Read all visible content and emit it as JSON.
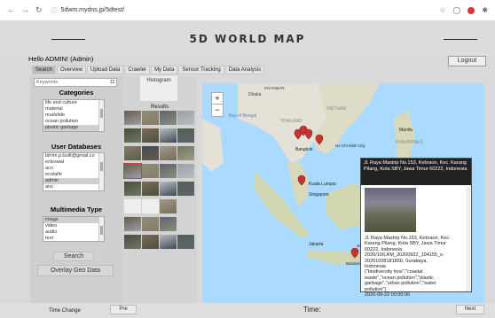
{
  "browser": {
    "url": "5dwm.mydns.jp/5dtest/"
  },
  "app": {
    "title": "5D WORLD MAP",
    "hello": "Hello ADMIN! (Admin)",
    "logout": "Logout"
  },
  "tabs": [
    "Search",
    "Overview",
    "Upload Data",
    "Crawler",
    "My Data",
    "Sensor Tracking",
    "Data Analysis"
  ],
  "search": {
    "keywords_placeholder": "Keywords"
  },
  "categories": {
    "title": "Categories",
    "items": [
      "life and culture",
      "material",
      "mudslide",
      "ocean pollution",
      "plastic garbage"
    ],
    "selected": "plastic garbage"
  },
  "user_databases": {
    "title": "User Databases",
    "items": [
      "bimm.p.built@gmail.co",
      "eclexwal",
      "aco",
      "ecolaife",
      "admin",
      "anz"
    ],
    "selected": "admin"
  },
  "multimedia": {
    "title": "Multimedia Type",
    "items": [
      "image",
      "video",
      "audio",
      "text"
    ],
    "selected": "image"
  },
  "buttons": {
    "search": "Search",
    "overlay": "Overlay Geo Data",
    "pre": "Pre",
    "next": "Next"
  },
  "middle": {
    "histogram": "Histogram",
    "results": "Results"
  },
  "map": {
    "labels": [
      "MYANMAR",
      "Dhaka",
      "Bay of Bengal",
      "THAILAND",
      "Bangkok",
      "VIETNAM",
      "Ho Chi Minh City",
      "Manila",
      "PHILIPPINES",
      "Kuala Lumpur",
      "Singapore",
      "Jakarta",
      "Bandung",
      "Surabaya"
    ],
    "zoom_in": "+",
    "zoom_out": "−"
  },
  "popup": {
    "header": "Jl. Raya Mastrip No.153, Kebraon, Kec. Karang Pilang, Kota SBY, Jawa Timur 60222, Indonesia",
    "body": [
      "Jl. Raya Mastrip No.153, Kebraon, Kec.",
      "Karang Pilang, Kota SBY, Jawa Timur",
      "60222, Indonesia",
      "2020/10/LRM_20200922_104155_s-",
      "20201008181850, Surabaya,",
      "Indonesia",
      "(\"biodiversity loss\",\"coastal",
      "waste\",\"ocean pollution\",\"plastic",
      "garbage\",\"urban pollution\",\"water",
      "pollution\")",
      "2020-09-22 00:00:00"
    ]
  },
  "footer": {
    "time_change": "Time Change",
    "time": "Time:"
  },
  "colors": {
    "map_water": "#aadaff",
    "pin": "#c8342f",
    "panel": "#d9d9d9"
  }
}
